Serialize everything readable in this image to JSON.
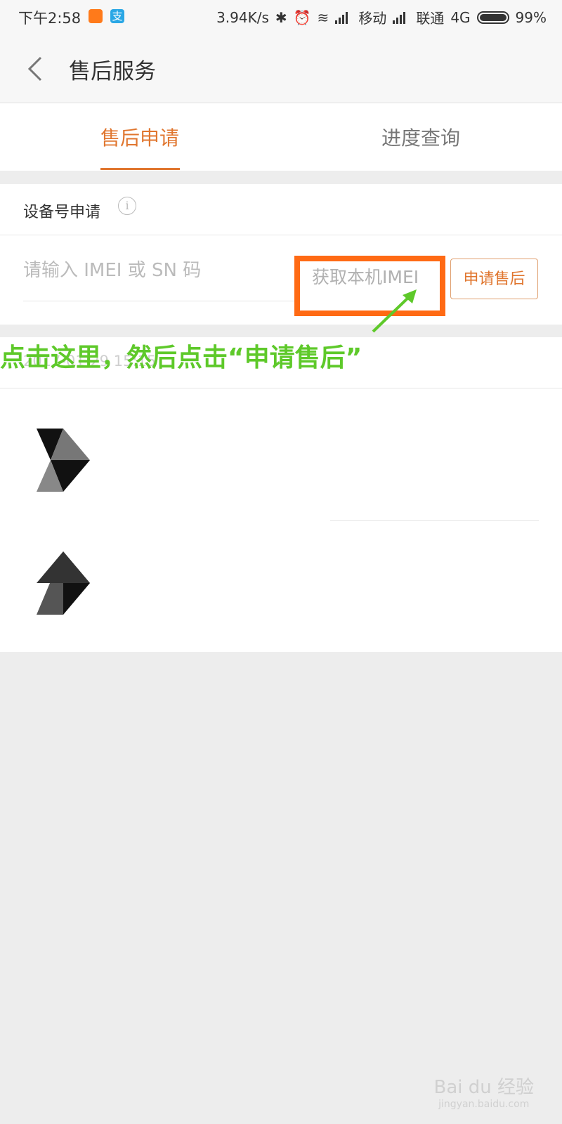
{
  "status_bar": {
    "time": "下午2:58",
    "speed": "3.94K/s",
    "carrier1": "移动",
    "carrier2": "联通",
    "network": "4G",
    "battery": "99%"
  },
  "header": {
    "title": "售后服务"
  },
  "tabs": [
    {
      "label": "售后申请",
      "active": true
    },
    {
      "label": "进度查询",
      "active": false
    }
  ],
  "device_section": {
    "heading": "设备号申请",
    "input_placeholder": "请输入 IMEI 或 SN 码",
    "get_imei_label": "获取本机IMEI",
    "apply_label": "申请售后"
  },
  "record": {
    "date": "2017-01-29 15:15"
  },
  "annotation": {
    "text": "点击这里，然后点击“申请售后”"
  },
  "watermark": {
    "brand": "Bai du 经验",
    "url": "jingyan.baidu.com"
  },
  "colors": {
    "accent": "#e0762f",
    "highlight": "#ff6a14",
    "annotation": "#5ec92a"
  }
}
